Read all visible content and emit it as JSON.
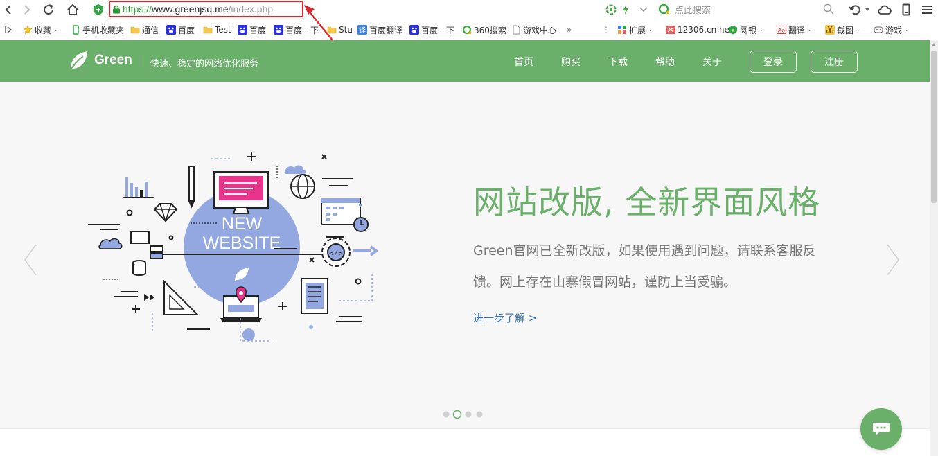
{
  "browser": {
    "address_bar": {
      "protocol": "https://",
      "host": "www.greenjsq.me",
      "path": "/index.php"
    },
    "search_placeholder": "点此搜索",
    "bookmarks": [
      {
        "label": "收藏",
        "icon": "star-icon"
      },
      {
        "label": "手机收藏夹",
        "icon": "phone-icon"
      },
      {
        "label": "通信",
        "icon": "folder-icon"
      },
      {
        "label": "百度",
        "icon": "baidu-paw-icon"
      },
      {
        "label": "Test",
        "icon": "folder-icon"
      },
      {
        "label": "百度",
        "icon": "baidu-paw-icon"
      },
      {
        "label": "百度一下",
        "icon": "baidu-paw-icon"
      },
      {
        "label": "Stu",
        "icon": "folder-icon"
      },
      {
        "label": "百度翻译",
        "icon": "translate-icon"
      },
      {
        "label": "百度一下",
        "icon": "baidu-paw-icon"
      },
      {
        "label": "360搜索",
        "icon": "360-search-icon"
      },
      {
        "label": "游戏中心",
        "icon": "page-icon"
      }
    ],
    "extensions": [
      {
        "label": "扩展",
        "icon": "puzzle-icon"
      },
      {
        "label": "12306.cn he",
        "icon": "ticket-icon"
      },
      {
        "label": "网银",
        "icon": "shield-icon"
      },
      {
        "label": "翻译",
        "icon": "dictionary-icon"
      },
      {
        "label": "截图",
        "icon": "scissors-icon"
      },
      {
        "label": "游戏",
        "icon": "gamepad-icon"
      }
    ]
  },
  "site": {
    "brand": "Green",
    "slogan": "快速、稳定的网络优化服务",
    "nav": [
      "首页",
      "购买",
      "下载",
      "帮助",
      "关于"
    ],
    "login_label": "登录",
    "register_label": "注册"
  },
  "hero": {
    "illustration_text_line1": "NEW",
    "illustration_text_line2": "WEBSITE",
    "title": "网站改版, 全新界面风格",
    "description": "Green官网已全新改版，如果使用遇到问题，请联系客服反馈。网上存在山寨假冒网站，谨防上当受骗。",
    "more_link": "进一步了解 >",
    "slide_count": 4,
    "active_slide": 2
  },
  "colors": {
    "brand_green": "#6ab06b",
    "annotation_red": "#d9282b",
    "link_blue": "#3a75b8",
    "illustration_blue": "#93a8e0",
    "illustration_pink": "#e8358b"
  }
}
